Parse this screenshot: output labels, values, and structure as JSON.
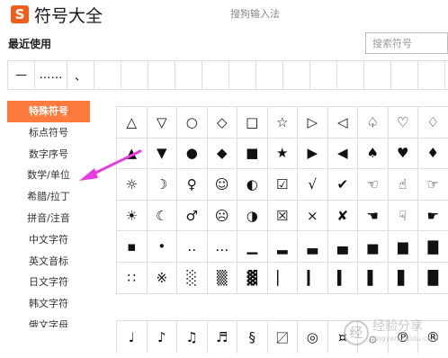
{
  "window": {
    "logo_glyph": "S",
    "title": "符号大全",
    "subtitle": "搜狗输入法"
  },
  "recent": {
    "label": "最近使用",
    "items": [
      "—",
      "……",
      "、",
      "",
      "",
      "",
      "",
      "",
      "",
      "",
      "",
      "",
      "",
      "",
      "",
      ""
    ]
  },
  "search": {
    "placeholder": "搜索符号",
    "value": ""
  },
  "sidebar": {
    "active_color": "#ff7a3d",
    "items": [
      {
        "label": "特殊符号",
        "active": true
      },
      {
        "label": "标点符号",
        "active": false
      },
      {
        "label": "数字序号",
        "active": false
      },
      {
        "label": "数学/单位",
        "active": false
      },
      {
        "label": "希腊/拉丁",
        "active": false
      },
      {
        "label": "拼音/注音",
        "active": false
      },
      {
        "label": "中文字符",
        "active": false
      },
      {
        "label": "英文音标",
        "active": false
      },
      {
        "label": "日文字符",
        "active": false
      },
      {
        "label": "韩文字符",
        "active": false
      },
      {
        "label": "俄文字母",
        "active": false
      }
    ]
  },
  "symbols": {
    "rows": [
      [
        "△",
        "▽",
        "○",
        "◇",
        "□",
        "☆",
        "▷",
        "◁",
        "♤",
        "♡",
        "♢"
      ],
      [
        "▲",
        "▼",
        "●",
        "◆",
        "■",
        "★",
        "▶",
        "◀",
        "♠",
        "♥",
        "♦"
      ],
      [
        "☼",
        "☽",
        "♀",
        "☺",
        "◐",
        "☑",
        "√",
        "✔",
        "☜",
        "☝",
        "☞"
      ],
      [
        "☀",
        "☾",
        "♂",
        "☹",
        "◑",
        "☒",
        "×",
        "✘",
        "☚",
        "☟",
        "☛"
      ],
      [
        "▪",
        "•",
        "‥",
        "…",
        "▁",
        "▂",
        "▃",
        "▄",
        "▅",
        "▆",
        "▇"
      ],
      [
        "∷",
        "※",
        "░",
        "▒",
        "▓",
        "▏",
        "▎",
        "▍",
        "▌",
        "▋",
        "█"
      ]
    ],
    "second_rows": [
      [
        "♩",
        "♪",
        "♫",
        "♬",
        "§",
        "〼",
        "◎",
        "¤",
        "۞",
        "℗",
        "®"
      ]
    ]
  },
  "annotation": {
    "arrow_color": "#e83ae0"
  },
  "watermark": {
    "badge": "经",
    "text": "经验分享",
    "url": "jingyan.baidu.com"
  }
}
